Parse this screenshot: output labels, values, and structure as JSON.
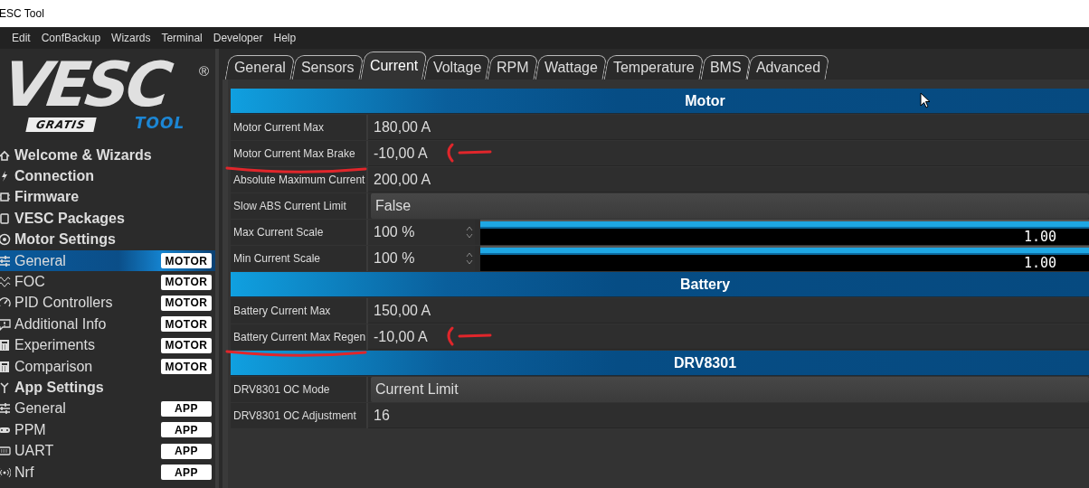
{
  "window": {
    "title": "ESC Tool"
  },
  "menu": [
    "Edit",
    "ConfBackup",
    "Wizards",
    "Terminal",
    "Developer",
    "Help"
  ],
  "logo": {
    "wordmark": "VESC",
    "mark": "®",
    "badge": "GRATIS",
    "sub": "TOOL"
  },
  "sidebar": {
    "items": [
      {
        "label": "Welcome & Wizards",
        "kind": "header",
        "selected": false
      },
      {
        "label": "Connection",
        "kind": "header",
        "selected": false
      },
      {
        "label": "Firmware",
        "kind": "header",
        "selected": false
      },
      {
        "label": "VESC Packages",
        "kind": "header",
        "selected": false
      },
      {
        "label": "Motor Settings",
        "kind": "header",
        "selected": false
      },
      {
        "label": "General",
        "kind": "page",
        "badge": "MOTOR",
        "selected": true
      },
      {
        "label": "FOC",
        "kind": "page",
        "badge": "MOTOR",
        "selected": false
      },
      {
        "label": "PID Controllers",
        "kind": "page",
        "badge": "MOTOR",
        "selected": false
      },
      {
        "label": "Additional Info",
        "kind": "page",
        "badge": "MOTOR",
        "selected": false
      },
      {
        "label": "Experiments",
        "kind": "page",
        "badge": "MOTOR",
        "selected": false
      },
      {
        "label": "Comparison",
        "kind": "page",
        "badge": "MOTOR",
        "selected": false
      },
      {
        "label": "App Settings",
        "kind": "header",
        "selected": false
      },
      {
        "label": "General",
        "kind": "page",
        "badge": "APP",
        "selected": false
      },
      {
        "label": "PPM",
        "kind": "page",
        "badge": "APP",
        "selected": false
      },
      {
        "label": "UART",
        "kind": "page",
        "badge": "APP",
        "selected": false
      },
      {
        "label": "Nrf",
        "kind": "page",
        "badge": "APP",
        "selected": false
      }
    ]
  },
  "tabs": [
    {
      "label": "General",
      "selected": false
    },
    {
      "label": "Sensors",
      "selected": false
    },
    {
      "label": "Current",
      "selected": true
    },
    {
      "label": "Voltage",
      "selected": false
    },
    {
      "label": "RPM",
      "selected": false
    },
    {
      "label": "Wattage",
      "selected": false
    },
    {
      "label": "Temperature",
      "selected": false
    },
    {
      "label": "BMS",
      "selected": false
    },
    {
      "label": "Advanced",
      "selected": false
    }
  ],
  "sections": [
    {
      "title": "Motor",
      "rows": [
        {
          "label": "Motor Current Max",
          "kind": "value",
          "value": "180,00 A",
          "marked": false
        },
        {
          "label": "Motor Current Max Brake",
          "kind": "value",
          "value": "-10,00 A",
          "marked": true
        },
        {
          "label": "Absolute Maximum Current",
          "kind": "value",
          "value": "200,00 A",
          "marked": false
        },
        {
          "label": "Slow ABS Current Limit",
          "kind": "combo",
          "value": "False",
          "marked": false
        },
        {
          "label": "Max Current Scale",
          "kind": "scale",
          "value": "100 %",
          "level": 1,
          "reading": "1.00",
          "marked": false
        },
        {
          "label": "Min Current Scale",
          "kind": "scale",
          "value": "100 %",
          "level": 1,
          "reading": "1.00",
          "marked": false
        }
      ]
    },
    {
      "title": "Battery",
      "rows": [
        {
          "label": "Battery Current Max",
          "kind": "value",
          "value": "150,00 A",
          "marked": false
        },
        {
          "label": "Battery Current Max Regen",
          "kind": "value",
          "value": "-10,00 A",
          "marked": true
        }
      ]
    },
    {
      "title": "DRV8301",
      "rows": [
        {
          "label": "DRV8301 OC Mode",
          "kind": "combo",
          "value": "Current Limit",
          "marked": false
        },
        {
          "label": "DRV8301 OC Adjustment",
          "kind": "value",
          "value": "16",
          "marked": false
        }
      ]
    }
  ]
}
